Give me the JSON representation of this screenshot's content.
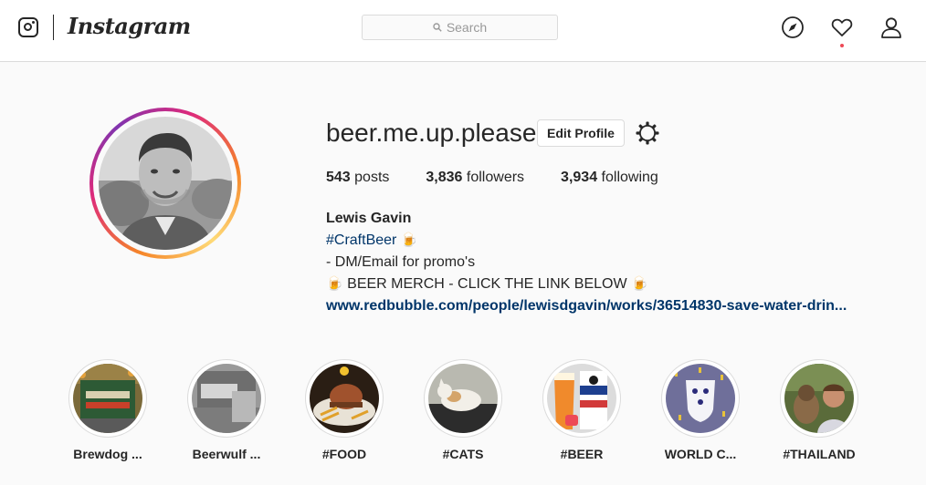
{
  "nav": {
    "brand": "Instagram",
    "search_placeholder": "Search"
  },
  "profile": {
    "username": "beer.me.up.please",
    "edit_label": "Edit Profile",
    "stats": {
      "posts_count": "543",
      "posts_label": "posts",
      "followers_count": "3,836",
      "followers_label": "followers",
      "following_count": "3,934",
      "following_label": "following"
    },
    "bio": {
      "name": "Lewis Gavin",
      "hashtag": "#CraftBeer",
      "line2": "- DM/Email for promo's",
      "line3": "BEER MERCH - CLICK THE LINK BELOW",
      "link": "www.redbubble.com/people/lewisdgavin/works/36514830-save-water-drin..."
    }
  },
  "highlights": [
    {
      "label": "Brewdog ..."
    },
    {
      "label": "Beerwulf ..."
    },
    {
      "label": "#FOOD"
    },
    {
      "label": "#CATS"
    },
    {
      "label": "#BEER"
    },
    {
      "label": "WORLD C..."
    },
    {
      "label": "#THAILAND"
    }
  ],
  "icons": {
    "camera": "instagram-camera-icon",
    "search": "search-icon",
    "explore": "compass-icon",
    "activity": "heart-icon",
    "profile": "person-icon",
    "settings": "gear-icon",
    "emoji": "beer-mug-emoji"
  },
  "colors": {
    "link": "#003569",
    "notification": "#ed4956",
    "ring_start": "#f58529",
    "ring_end": "#dd2a7b"
  }
}
